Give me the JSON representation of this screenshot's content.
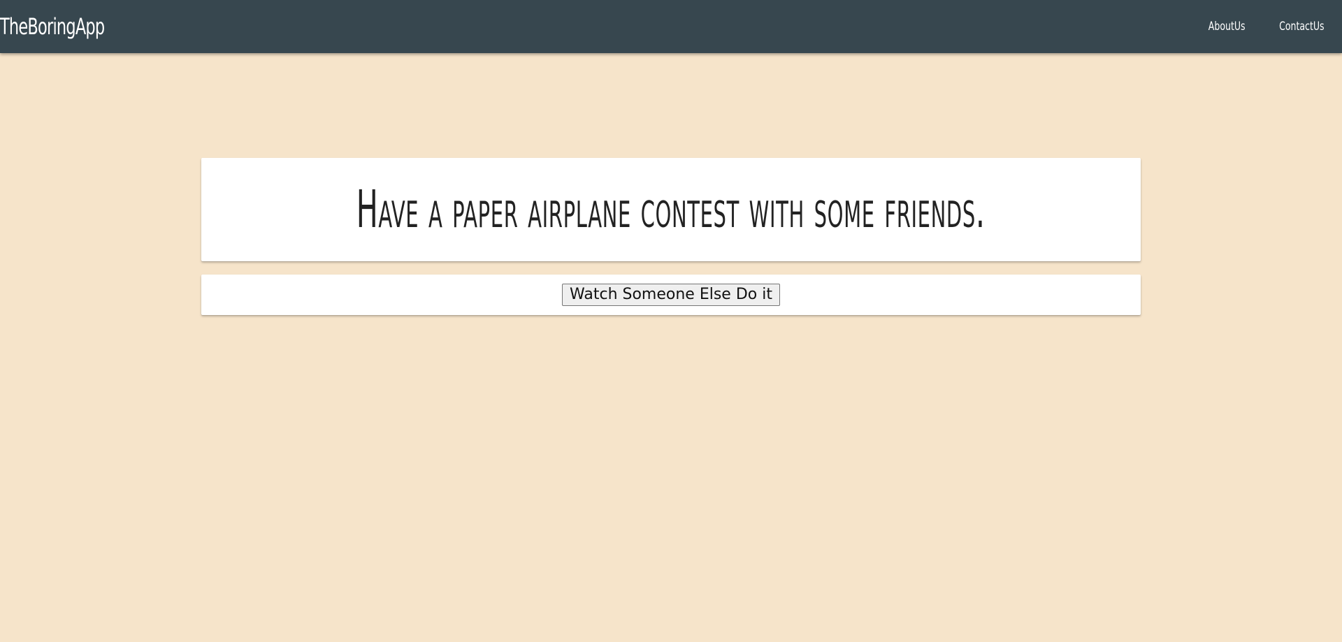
{
  "navbar": {
    "brand": "TheBoringApp",
    "links": [
      {
        "label": "AboutUs"
      },
      {
        "label": "ContactUs"
      }
    ]
  },
  "activity": {
    "text": "Have a paper airplane contest with some friends."
  },
  "action": {
    "button_label": "Watch Someone Else Do it"
  },
  "colors": {
    "navbar_bg": "#37474f",
    "page_bg": "#f6e4ca",
    "card_bg": "#ffffff"
  }
}
